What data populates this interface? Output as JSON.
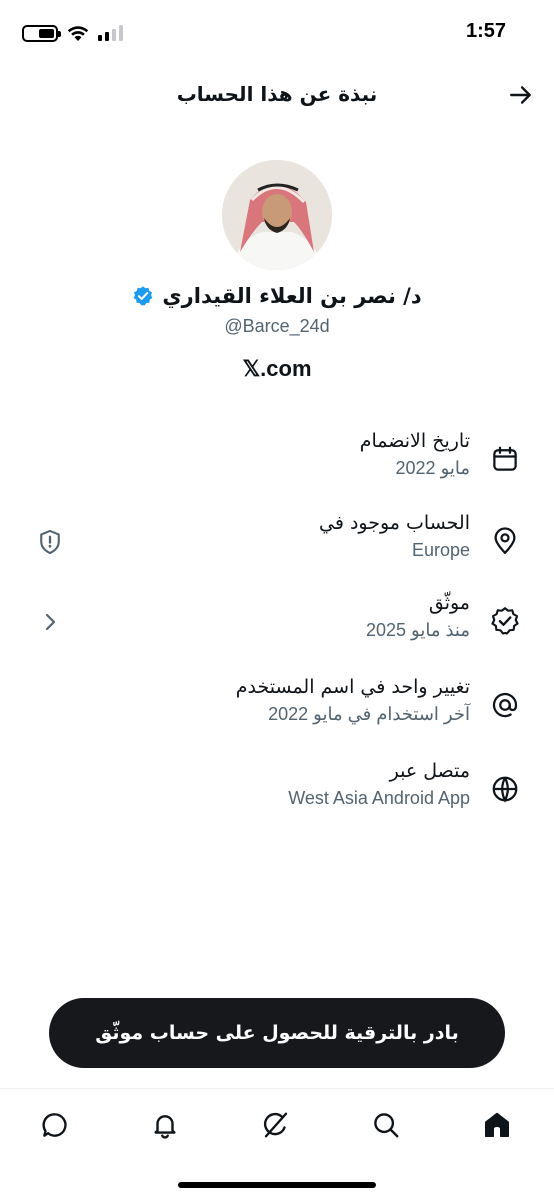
{
  "status_bar": {
    "time": "1:57",
    "battery_level": 0.55
  },
  "header": {
    "title": "نبذة عن هذا الحساب",
    "back_icon": "arrow-right-icon"
  },
  "profile": {
    "display_name": "د/ نصر بن العلاء القيداري",
    "handle": "@Barce_24d",
    "site": "𝕏.com",
    "verified_color": "#1d9bf0"
  },
  "info": [
    {
      "title": "تاريخ الانضمام",
      "subtitle": "مايو 2022",
      "icon": "calendar-icon"
    },
    {
      "title": "الحساب موجود في",
      "subtitle": "Europe",
      "icon": "location-pin-icon",
      "side_icon": "shield-icon"
    },
    {
      "title": "موثّق",
      "subtitle": "منذ مايو 2025",
      "icon": "verified-badge-icon",
      "side_icon": "chevron-right-icon"
    },
    {
      "title": "تغيير واحد في اسم المستخدم",
      "subtitle": "آخر استخدام في مايو 2022",
      "icon": "at-sign-icon"
    },
    {
      "title": "متصل عبر",
      "subtitle": "West Asia Android App",
      "icon": "globe-icon"
    }
  ],
  "upgrade_button": {
    "label": "بادر بالترقية للحصول على حساب موثّق"
  },
  "nav": [
    "messages-icon",
    "notifications-icon",
    "grok-icon",
    "search-icon",
    "home-icon"
  ],
  "colors": {
    "text": "#0f1419",
    "secondary": "#536471",
    "button_bg": "#16181c"
  }
}
